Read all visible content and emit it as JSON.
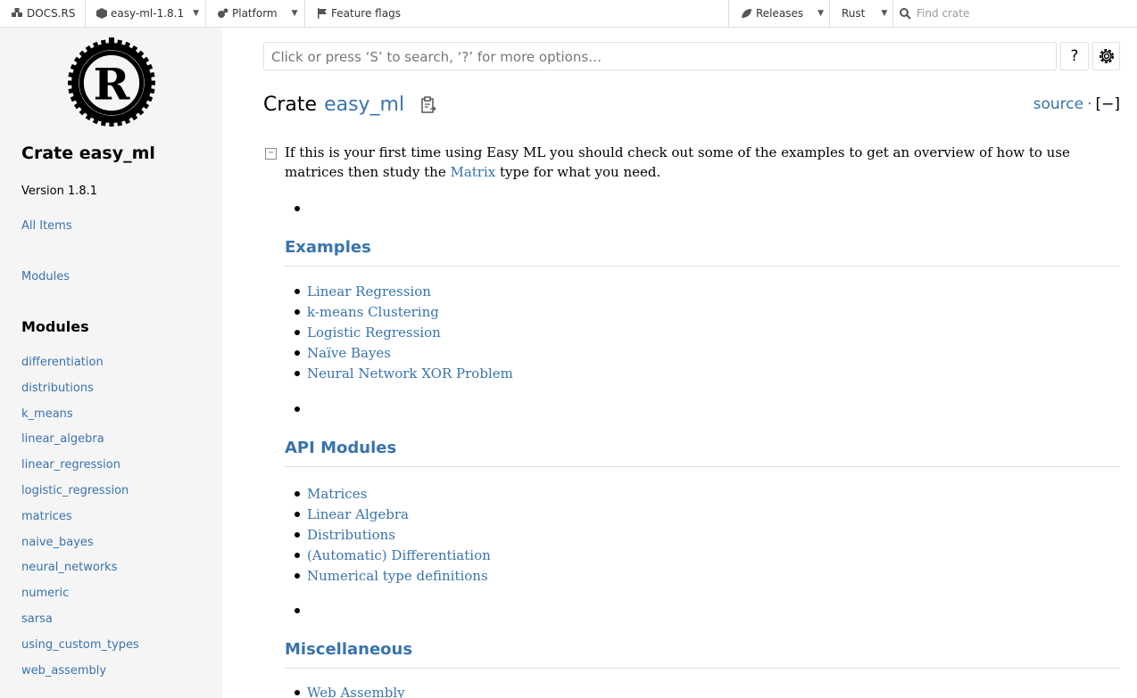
{
  "topnav": {
    "docsrs": "DOCS.RS",
    "crate_version": "easy-ml-1.8.1",
    "platform": "Platform",
    "feature_flags": "Feature flags",
    "releases": "Releases",
    "rust": "Rust",
    "find_placeholder": "Find crate"
  },
  "sidebar": {
    "title": "Crate easy_ml",
    "version": "Version 1.8.1",
    "all_items": "All Items",
    "modules_link": "Modules",
    "modules_heading": "Modules",
    "modules": [
      "differentiation",
      "distributions",
      "k_means",
      "linear_algebra",
      "linear_regression",
      "logistic_regression",
      "matrices",
      "naive_bayes",
      "neural_networks",
      "numeric",
      "sarsa",
      "using_custom_types",
      "web_assembly"
    ]
  },
  "search": {
    "placeholder": "Click or press ‘S’ to search, ‘?’ for more options…",
    "help": "?"
  },
  "main": {
    "crate_label": "Crate",
    "crate_name": "easy_ml",
    "source": "source",
    "dot": "·",
    "collapse": "[−]",
    "toggle": "−",
    "intro_before": "If this is your first time using Easy ML you should check out some of the examples to get an overview of how to use matrices then study the ",
    "intro_link": "Matrix",
    "intro_after": " type for what you need.",
    "sections": [
      {
        "heading": "Examples",
        "items": [
          "Linear Regression",
          "k-means Clustering",
          "Logistic Regression",
          "Naïve Bayes",
          "Neural Network XOR Problem"
        ]
      },
      {
        "heading": "API Modules",
        "items": [
          "Matrices",
          "Linear Algebra",
          "Distributions",
          "(Automatic) Differentiation",
          "Numerical type definitions"
        ]
      },
      {
        "heading": "Miscellaneous",
        "items": [
          "Web Assembly"
        ]
      }
    ]
  }
}
